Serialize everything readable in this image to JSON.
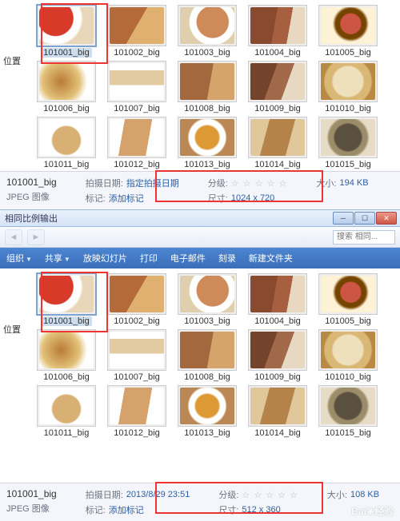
{
  "side_label": "位置",
  "window_title": "相同比例输出",
  "nav": {
    "search_placeholder": "搜索 相同..."
  },
  "toolbar": {
    "organize": "组织",
    "share": "共享",
    "slideshow": "放映幻灯片",
    "print": "打印",
    "email": "电子邮件",
    "burn": "刻录",
    "new_folder": "新建文件夹"
  },
  "items": [
    {
      "name": "101001_big"
    },
    {
      "name": "101002_big"
    },
    {
      "name": "101003_big"
    },
    {
      "name": "101004_big"
    },
    {
      "name": "101005_big"
    },
    {
      "name": "101006_big"
    },
    {
      "name": "101007_big"
    },
    {
      "name": "101008_big"
    },
    {
      "name": "101009_big"
    },
    {
      "name": "101010_big"
    },
    {
      "name": "101011_big"
    },
    {
      "name": "101012_big"
    },
    {
      "name": "101013_big"
    },
    {
      "name": "101014_big"
    },
    {
      "name": "101015_big"
    }
  ],
  "details_top": {
    "filename": "101001_big",
    "filetype": "JPEG 图像",
    "date_label": "拍摄日期:",
    "date_value": "指定拍摄日期",
    "tag_label": "标记:",
    "tag_value": "添加标记",
    "rating_label": "分级:",
    "stars": "☆ ☆ ☆ ☆ ☆",
    "dim_label": "尺寸:",
    "dim_value": "1024 x 720",
    "size_label": "大小:",
    "size_value": "194 KB"
  },
  "details_bottom": {
    "filename": "101001_big",
    "filetype": "JPEG 图像",
    "date_label": "拍摄日期:",
    "date_value": "2013/8/29 23:51",
    "tag_label": "标记:",
    "tag_value": "添加标记",
    "rating_label": "分级:",
    "stars": "☆ ☆ ☆ ☆ ☆",
    "dim_label": "尺寸:",
    "dim_value": "512 x 360",
    "size_label": "大小:",
    "size_value": "108 KB"
  },
  "watermark": "Bai❀经验"
}
